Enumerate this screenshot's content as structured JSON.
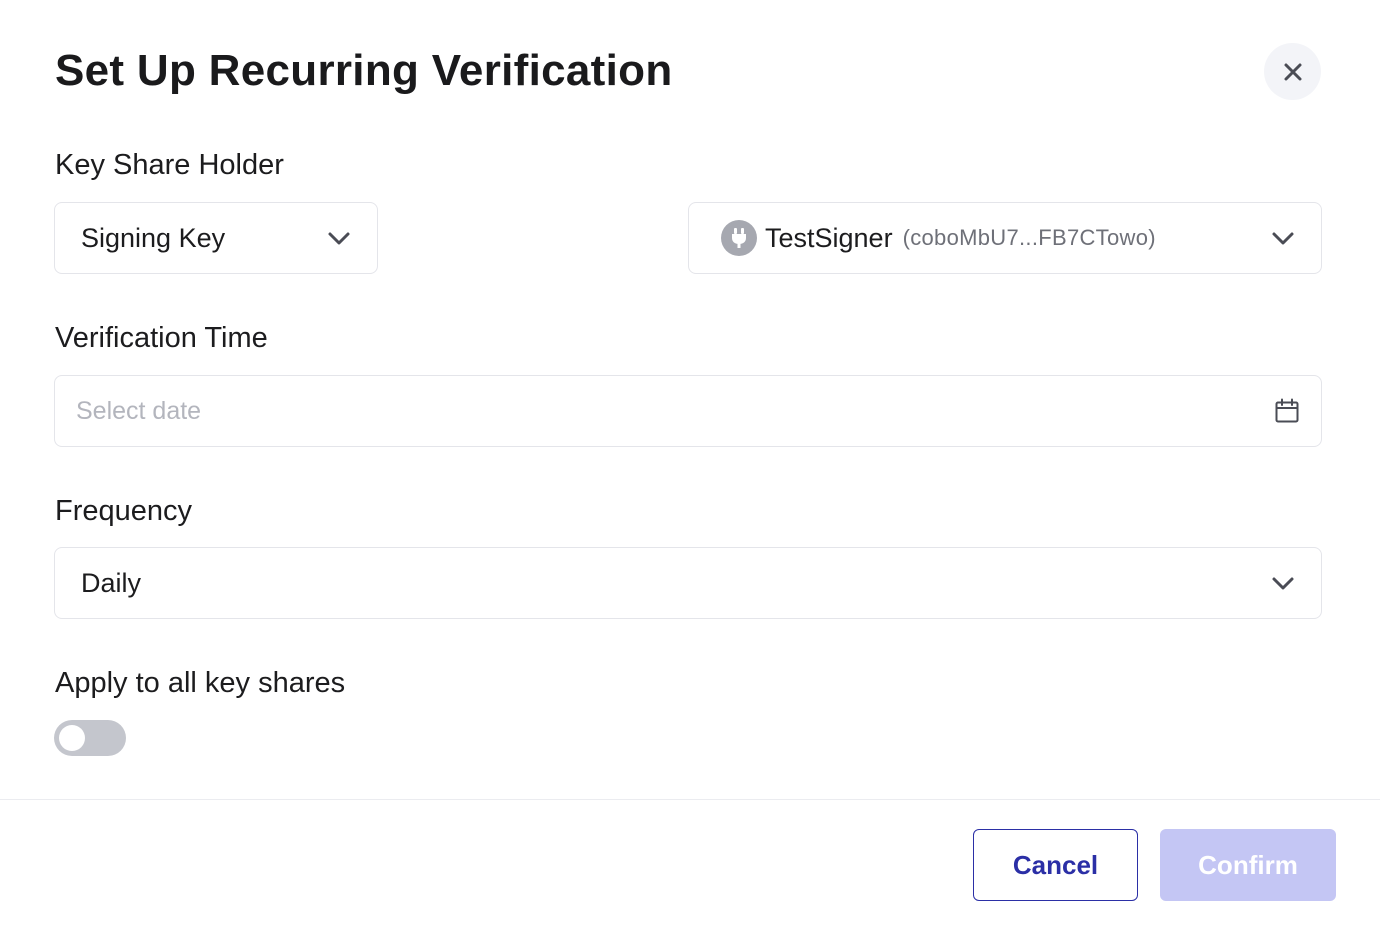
{
  "dialog": {
    "title": "Set Up Recurring Verification"
  },
  "key_share_holder": {
    "label": "Key Share Holder",
    "type_value": "Signing Key",
    "signer_name": "TestSigner",
    "signer_id": "(coboMbU7...FB7CTowo)"
  },
  "verification_time": {
    "label": "Verification Time",
    "placeholder": "Select date"
  },
  "frequency": {
    "label": "Frequency",
    "value": "Daily"
  },
  "apply_all": {
    "label": "Apply to all key shares",
    "enabled": false
  },
  "footer": {
    "cancel_label": "Cancel",
    "confirm_label": "Confirm"
  },
  "colors": {
    "primary": "#2b2fa6",
    "confirm_disabled": "#c4c6f4",
    "toggle_off": "#c4c6cd"
  },
  "icons": {
    "close": "close-icon",
    "chevron": "chevron-down-icon",
    "calendar": "calendar-icon",
    "signer": "plug-icon"
  }
}
